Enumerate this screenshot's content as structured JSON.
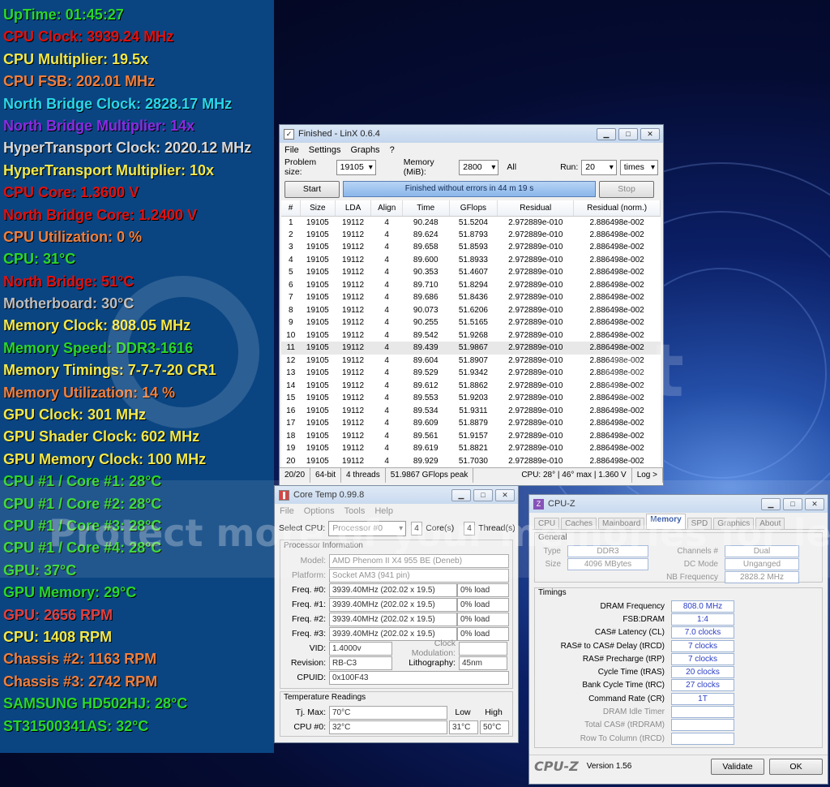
{
  "overlay_lines": [
    {
      "text": "UpTime: 01:45:27",
      "color": "#2bd62b"
    },
    {
      "text": "CPU Clock: 3939.24 MHz",
      "color": "#e01010"
    },
    {
      "text": "CPU Multiplier: 19.5x",
      "color": "#f2e84a"
    },
    {
      "text": "CPU FSB: 202.01 MHz",
      "color": "#f07f3e"
    },
    {
      "text": "North Bridge Clock: 2828.17 MHz",
      "color": "#2ad8e8"
    },
    {
      "text": "North Bridge Multiplier: 14x",
      "color": "#8a2be2"
    },
    {
      "text": "HyperTransport Clock: 2020.12 MHz",
      "color": "#d8d8d8"
    },
    {
      "text": "HyperTransport Multiplier: 10x",
      "color": "#f2e84a"
    },
    {
      "text": "CPU Core: 1.3600 V",
      "color": "#e01010"
    },
    {
      "text": "North Bridge Core: 1.2400 V",
      "color": "#e01010"
    },
    {
      "text": "CPU Utilization: 0 %",
      "color": "#f07f3e"
    },
    {
      "text": "CPU: 31°C",
      "color": "#2bd62b"
    },
    {
      "text": "North Bridge: 51°C",
      "color": "#e01010"
    },
    {
      "text": "Motherboard: 30°C",
      "color": "#bdbdbd"
    },
    {
      "text": "Memory Clock: 808.05 MHz",
      "color": "#f2e84a"
    },
    {
      "text": "Memory Speed: DDR3-1616",
      "color": "#2bd62b"
    },
    {
      "text": "Memory Timings: 7-7-7-20 CR1",
      "color": "#f2e84a"
    },
    {
      "text": "Memory Utilization: 14 %",
      "color": "#f07f3e"
    },
    {
      "text": "GPU Clock: 301 MHz",
      "color": "#f2e84a"
    },
    {
      "text": "GPU Shader Clock: 602 MHz",
      "color": "#f2e84a"
    },
    {
      "text": "GPU Memory Clock: 100 MHz",
      "color": "#f2e84a"
    },
    {
      "text": "CPU #1 / Core #1: 28°C",
      "color": "#2bd62b"
    },
    {
      "text": "CPU #1 / Core #2: 28°C",
      "color": "#2bd62b"
    },
    {
      "text": "CPU #1 / Core #3: 28°C",
      "color": "#2bd62b"
    },
    {
      "text": "CPU #1 / Core #4: 28°C",
      "color": "#2bd62b"
    },
    {
      "text": "GPU: 37°C",
      "color": "#2bd62b"
    },
    {
      "text": "GPU Memory: 29°C",
      "color": "#2bd62b"
    },
    {
      "text": "GPU: 2656 RPM",
      "color": "#e04040"
    },
    {
      "text": "CPU: 1408 RPM",
      "color": "#f2e84a"
    },
    {
      "text": "Chassis #2: 1163 RPM",
      "color": "#f07f3e"
    },
    {
      "text": "Chassis #3: 2742 RPM",
      "color": "#f07f3e"
    },
    {
      "text": "SAMSUNG HD502HJ: 28°C",
      "color": "#2bd62b"
    },
    {
      "text": "ST31500341AS: 32°C",
      "color": "#2bd62b"
    }
  ],
  "watermark": {
    "text": "Protect more of your memories for less!",
    "bg_text": "et"
  },
  "linx": {
    "title": "Finished - LinX 0.6.4",
    "menu": [
      "File",
      "Settings",
      "Graphs",
      "?"
    ],
    "problem_size_label": "Problem size:",
    "problem_size": "19105",
    "memory_label": "Memory (MiB):",
    "memory": "2800",
    "all_label": "All",
    "run_label": "Run:",
    "run": "20",
    "times": "times",
    "start": "Start",
    "progress": "Finished without errors in 44 m 19 s",
    "stop": "Stop",
    "columns": [
      "#",
      "Size",
      "LDA",
      "Align",
      "Time",
      "GFlops",
      "Residual",
      "Residual (norm.)"
    ],
    "rows": [
      [
        "1",
        "19105",
        "19112",
        "4",
        "90.248",
        "51.5204",
        "2.972889e-010",
        "2.886498e-002"
      ],
      [
        "2",
        "19105",
        "19112",
        "4",
        "89.624",
        "51.8793",
        "2.972889e-010",
        "2.886498e-002"
      ],
      [
        "3",
        "19105",
        "19112",
        "4",
        "89.658",
        "51.8593",
        "2.972889e-010",
        "2.886498e-002"
      ],
      [
        "4",
        "19105",
        "19112",
        "4",
        "89.600",
        "51.8933",
        "2.972889e-010",
        "2.886498e-002"
      ],
      [
        "5",
        "19105",
        "19112",
        "4",
        "90.353",
        "51.4607",
        "2.972889e-010",
        "2.886498e-002"
      ],
      [
        "6",
        "19105",
        "19112",
        "4",
        "89.710",
        "51.8294",
        "2.972889e-010",
        "2.886498e-002"
      ],
      [
        "7",
        "19105",
        "19112",
        "4",
        "89.686",
        "51.8436",
        "2.972889e-010",
        "2.886498e-002"
      ],
      [
        "8",
        "19105",
        "19112",
        "4",
        "90.073",
        "51.6206",
        "2.972889e-010",
        "2.886498e-002"
      ],
      [
        "9",
        "19105",
        "19112",
        "4",
        "90.255",
        "51.5165",
        "2.972889e-010",
        "2.886498e-002"
      ],
      [
        "10",
        "19105",
        "19112",
        "4",
        "89.542",
        "51.9268",
        "2.972889e-010",
        "2.886498e-002"
      ],
      [
        "11",
        "19105",
        "19112",
        "4",
        "89.439",
        "51.9867",
        "2.972889e-010",
        "2.886498e-002"
      ],
      [
        "12",
        "19105",
        "19112",
        "4",
        "89.604",
        "51.8907",
        "2.972889e-010",
        "2.886498e-002"
      ],
      [
        "13",
        "19105",
        "19112",
        "4",
        "89.529",
        "51.9342",
        "2.972889e-010",
        "2.886498e-002"
      ],
      [
        "14",
        "19105",
        "19112",
        "4",
        "89.612",
        "51.8862",
        "2.972889e-010",
        "2.886498e-002"
      ],
      [
        "15",
        "19105",
        "19112",
        "4",
        "89.553",
        "51.9203",
        "2.972889e-010",
        "2.886498e-002"
      ],
      [
        "16",
        "19105",
        "19112",
        "4",
        "89.534",
        "51.9311",
        "2.972889e-010",
        "2.886498e-002"
      ],
      [
        "17",
        "19105",
        "19112",
        "4",
        "89.609",
        "51.8879",
        "2.972889e-010",
        "2.886498e-002"
      ],
      [
        "18",
        "19105",
        "19112",
        "4",
        "89.561",
        "51.9157",
        "2.972889e-010",
        "2.886498e-002"
      ],
      [
        "19",
        "19105",
        "19112",
        "4",
        "89.619",
        "51.8821",
        "2.972889e-010",
        "2.886498e-002"
      ],
      [
        "20",
        "19105",
        "19112",
        "4",
        "89.929",
        "51.7030",
        "2.972889e-010",
        "2.886498e-002"
      ]
    ],
    "status": [
      "20/20",
      "64-bit",
      "4 threads",
      "51.9867 GFlops peak",
      "CPU: 28° | 46° max | 1.360 V",
      "Log >"
    ]
  },
  "coretemp": {
    "title": "Core Temp 0.99.8",
    "menu": [
      "File",
      "Options",
      "Tools",
      "Help"
    ],
    "select_cpu_label": "Select CPU:",
    "select_cpu": "Processor #0",
    "cores": "4",
    "cores_label": "Core(s)",
    "threads": "4",
    "threads_label": "Thread(s)",
    "proc_info_label": "Processor Information",
    "model_label": "Model:",
    "model": "AMD Phenom II X4 955 BE (Deneb)",
    "platform_label": "Platform:",
    "platform": "Socket AM3 (941 pin)",
    "freqs": [
      {
        "label": "Freq. #0:",
        "value": "3939.40MHz (202.02 x 19.5)",
        "load": "0% load"
      },
      {
        "label": "Freq. #1:",
        "value": "3939.40MHz (202.02 x 19.5)",
        "load": "0% load"
      },
      {
        "label": "Freq. #2:",
        "value": "3939.40MHz (202.02 x 19.5)",
        "load": "0% load"
      },
      {
        "label": "Freq. #3:",
        "value": "3939.40MHz (202.02 x 19.5)",
        "load": "0% load"
      }
    ],
    "vid_label": "VID:",
    "vid": "1.4000v",
    "clockmod_label": "Clock Modulation:",
    "revision_label": "Revision:",
    "revision": "RB-C3",
    "litho_label": "Lithography:",
    "litho": "45nm",
    "cpuid_label": "CPUID:",
    "cpuid": "0x100F43",
    "temp_label": "Temperature Readings",
    "tjmax_label": "Tj. Max:",
    "tjmax": "70°C",
    "low_label": "Low",
    "high_label": "High",
    "cpu0_label": "CPU #0:",
    "cpu0": "32°C",
    "low": "31°C",
    "high": "50°C"
  },
  "cpuz": {
    "title": "CPU-Z",
    "tabs": [
      "CPU",
      "Caches",
      "Mainboard",
      "Memory",
      "SPD",
      "Graphics",
      "About"
    ],
    "general_label": "General",
    "type_label": "Type",
    "type": "DDR3",
    "channels_label": "Channels #",
    "channels": "Dual",
    "size_label": "Size",
    "size": "4096 MBytes",
    "dcmode_label": "DC Mode",
    "dcmode": "Unganged",
    "nbfreq_label": "NB Frequency",
    "nbfreq": "2828.2 MHz",
    "timings_label": "Timings",
    "timings": [
      {
        "label": "DRAM Frequency",
        "value": "808.0 MHz"
      },
      {
        "label": "FSB:DRAM",
        "value": "1:4"
      },
      {
        "label": "CAS# Latency (CL)",
        "value": "7.0 clocks"
      },
      {
        "label": "RAS# to CAS# Delay (tRCD)",
        "value": "7 clocks"
      },
      {
        "label": "RAS# Precharge (tRP)",
        "value": "7 clocks"
      },
      {
        "label": "Cycle Time (tRAS)",
        "value": "20 clocks"
      },
      {
        "label": "Bank Cycle Time (tRC)",
        "value": "27 clocks"
      },
      {
        "label": "Command Rate (CR)",
        "value": "1T"
      },
      {
        "label": "DRAM Idle Timer",
        "value": ""
      },
      {
        "label": "Total CAS# (tRDRAM)",
        "value": ""
      },
      {
        "label": "Row To Column (tRCD)",
        "value": ""
      }
    ],
    "brand": "CPU-Z",
    "version": "Version 1.56",
    "validate": "Validate",
    "ok": "OK"
  }
}
